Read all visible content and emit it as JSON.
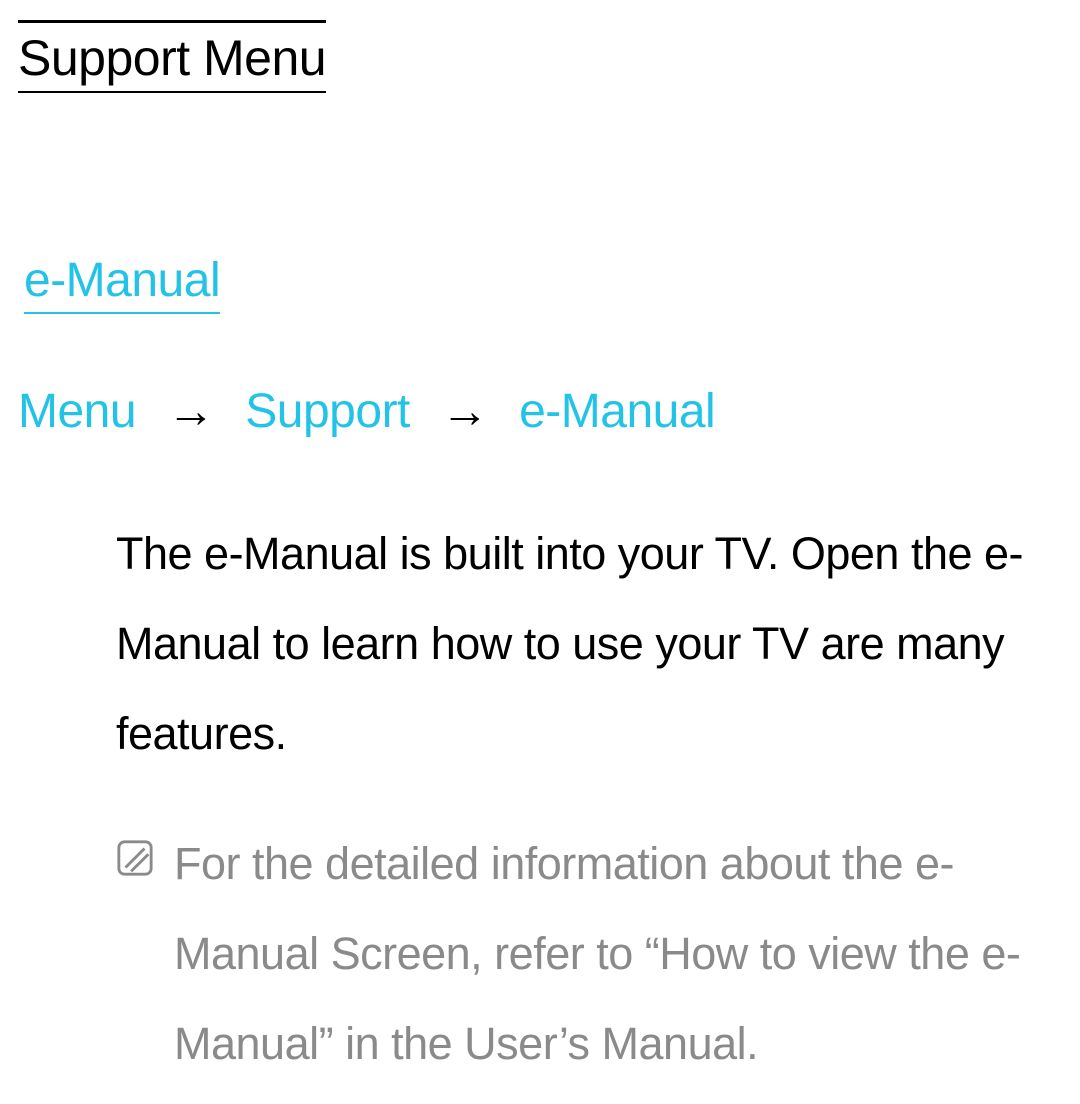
{
  "title": "Support Menu",
  "section_heading": "e-Manual",
  "breadcrumb": {
    "items": [
      "Menu",
      "Support",
      "e-Manual"
    ],
    "separator": "→"
  },
  "body_text": "The e-Manual is built into your TV. Open the e-Manual to learn how to use your TV are many features.",
  "note_text": "For the detailed information about the e-Manual Screen, refer to “How to view the e-Manual” in the User’s Manual.",
  "colors": {
    "accent": "#23c3e8",
    "note_gray": "#8a8a8a"
  }
}
